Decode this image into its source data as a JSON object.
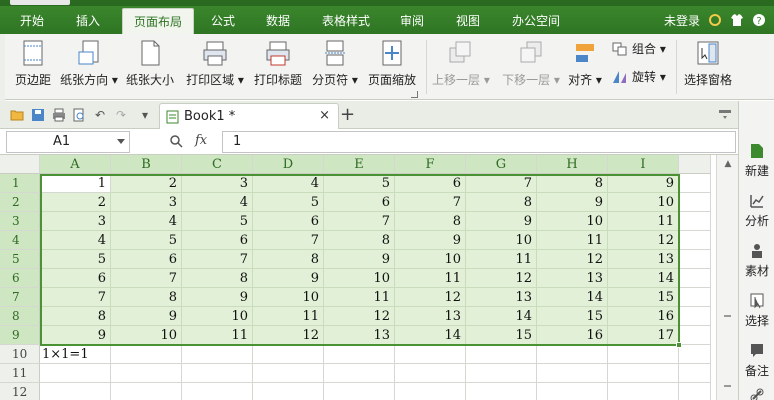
{
  "menu": {
    "tabs": [
      "开始",
      "插入",
      "页面布局",
      "公式",
      "数据",
      "表格样式",
      "审阅",
      "视图",
      "办公空间"
    ],
    "active_tab": "页面布局",
    "login": "未登录"
  },
  "ribbon": {
    "margins": "页边距",
    "orientation": "纸张方向",
    "size": "纸张大小",
    "print_area": "打印区域",
    "print_titles": "打印标题",
    "page_break": "分页符",
    "page_zoom": "页面缩放",
    "bring_forward": "上移一层",
    "send_backward": "下移一层",
    "align": "对齐",
    "group": "组合",
    "rotate": "旋转",
    "selection_pane": "选择窗格"
  },
  "doc": {
    "tab_name": "Book1 *",
    "close": "×",
    "add": "+"
  },
  "formula_bar": {
    "name_box": "A1",
    "fx": "fx",
    "value": "1"
  },
  "sheet": {
    "columns": [
      "A",
      "B",
      "C",
      "D",
      "E",
      "F",
      "G",
      "H",
      "I"
    ],
    "row_numbers": [
      "1",
      "2",
      "3",
      "4",
      "5",
      "6",
      "7",
      "8",
      "9",
      "10",
      "11",
      "12"
    ],
    "rows": [
      [
        "1",
        "2",
        "3",
        "4",
        "5",
        "6",
        "7",
        "8",
        "9"
      ],
      [
        "2",
        "3",
        "4",
        "5",
        "6",
        "7",
        "8",
        "9",
        "10"
      ],
      [
        "3",
        "4",
        "5",
        "6",
        "7",
        "8",
        "9",
        "10",
        "11"
      ],
      [
        "4",
        "5",
        "6",
        "7",
        "8",
        "9",
        "10",
        "11",
        "12"
      ],
      [
        "5",
        "6",
        "7",
        "8",
        "9",
        "10",
        "11",
        "12",
        "13"
      ],
      [
        "6",
        "7",
        "8",
        "9",
        "10",
        "11",
        "12",
        "13",
        "14"
      ],
      [
        "7",
        "8",
        "9",
        "10",
        "11",
        "12",
        "13",
        "14",
        "15"
      ],
      [
        "8",
        "9",
        "10",
        "11",
        "12",
        "13",
        "14",
        "15",
        "16"
      ],
      [
        "9",
        "10",
        "11",
        "12",
        "13",
        "14",
        "15",
        "16",
        "17"
      ]
    ],
    "a10": "1×1=1"
  },
  "taskpane": {
    "items": [
      "新建",
      "分析",
      "素材",
      "选择",
      "备注"
    ]
  },
  "colors": {
    "accent": "#3d8a2e",
    "selection_fill": "#e1f0d6",
    "selection_border": "#4a9234"
  }
}
